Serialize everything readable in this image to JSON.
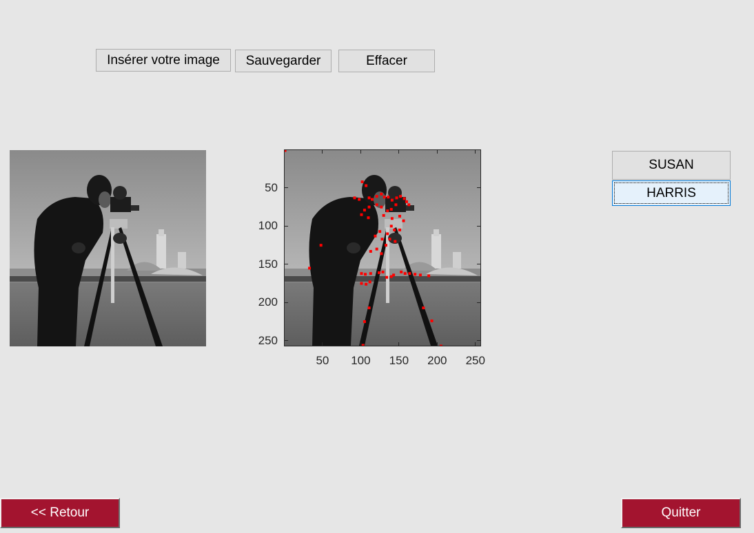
{
  "toolbar": {
    "insert_label": "Insérer votre image",
    "save_label": "Sauvegarder",
    "clear_label": "Effacer"
  },
  "methods": {
    "susan_label": "SUSAN",
    "harris_label": "HARRIS",
    "selected": "HARRIS"
  },
  "nav": {
    "back_label": "<< Retour",
    "quit_label": "Quitter"
  },
  "axes": {
    "x_ticks": [
      "50",
      "100",
      "150",
      "200",
      "250"
    ],
    "y_ticks": [
      "50",
      "100",
      "150",
      "200",
      "250"
    ],
    "x_range": [
      0.5,
      256.5
    ],
    "y_range": [
      0.5,
      256.5
    ],
    "y_direction": "reverse"
  },
  "corner_marker_color": "#ff0000",
  "chart_data": {
    "type": "scatter",
    "x_range": [
      0.5,
      256.5
    ],
    "y_range": [
      0.5,
      256.5
    ],
    "x_ticks": [
      50,
      100,
      150,
      200,
      250
    ],
    "y_ticks": [
      50,
      100,
      150,
      200,
      250
    ],
    "points": [
      [
        1,
        1
      ],
      [
        102,
        42
      ],
      [
        107,
        47
      ],
      [
        92,
        63
      ],
      [
        98,
        65
      ],
      [
        111,
        63
      ],
      [
        115,
        65
      ],
      [
        121,
        61
      ],
      [
        127,
        58
      ],
      [
        131,
        62
      ],
      [
        136,
        62
      ],
      [
        141,
        66
      ],
      [
        147,
        63
      ],
      [
        152,
        61
      ],
      [
        157,
        64
      ],
      [
        160,
        68
      ],
      [
        163,
        72
      ],
      [
        146,
        72
      ],
      [
        140,
        78
      ],
      [
        135,
        80
      ],
      [
        127,
        75
      ],
      [
        121,
        72
      ],
      [
        111,
        75
      ],
      [
        105,
        79
      ],
      [
        101,
        85
      ],
      [
        110,
        89
      ],
      [
        130,
        86
      ],
      [
        141,
        90
      ],
      [
        151,
        87
      ],
      [
        156,
        93
      ],
      [
        140,
        100
      ],
      [
        144,
        105
      ],
      [
        135,
        110
      ],
      [
        125,
        107
      ],
      [
        119,
        113
      ],
      [
        128,
        117
      ],
      [
        138,
        117
      ],
      [
        151,
        105
      ],
      [
        145,
        120
      ],
      [
        133,
        125
      ],
      [
        127,
        136
      ],
      [
        121,
        130
      ],
      [
        113,
        133
      ],
      [
        48,
        125
      ],
      [
        33,
        155
      ],
      [
        101,
        162
      ],
      [
        106,
        163
      ],
      [
        113,
        162
      ],
      [
        124,
        161
      ],
      [
        129,
        160
      ],
      [
        134,
        167
      ],
      [
        140,
        166
      ],
      [
        143,
        164
      ],
      [
        153,
        160
      ],
      [
        158,
        162
      ],
      [
        164,
        162
      ],
      [
        171,
        163
      ],
      [
        178,
        164
      ],
      [
        189,
        165
      ],
      [
        101,
        175
      ],
      [
        107,
        176
      ],
      [
        112,
        173
      ],
      [
        111,
        207
      ],
      [
        182,
        207
      ],
      [
        105,
        225
      ],
      [
        193,
        224
      ],
      [
        103,
        256
      ],
      [
        205,
        257
      ]
    ]
  }
}
